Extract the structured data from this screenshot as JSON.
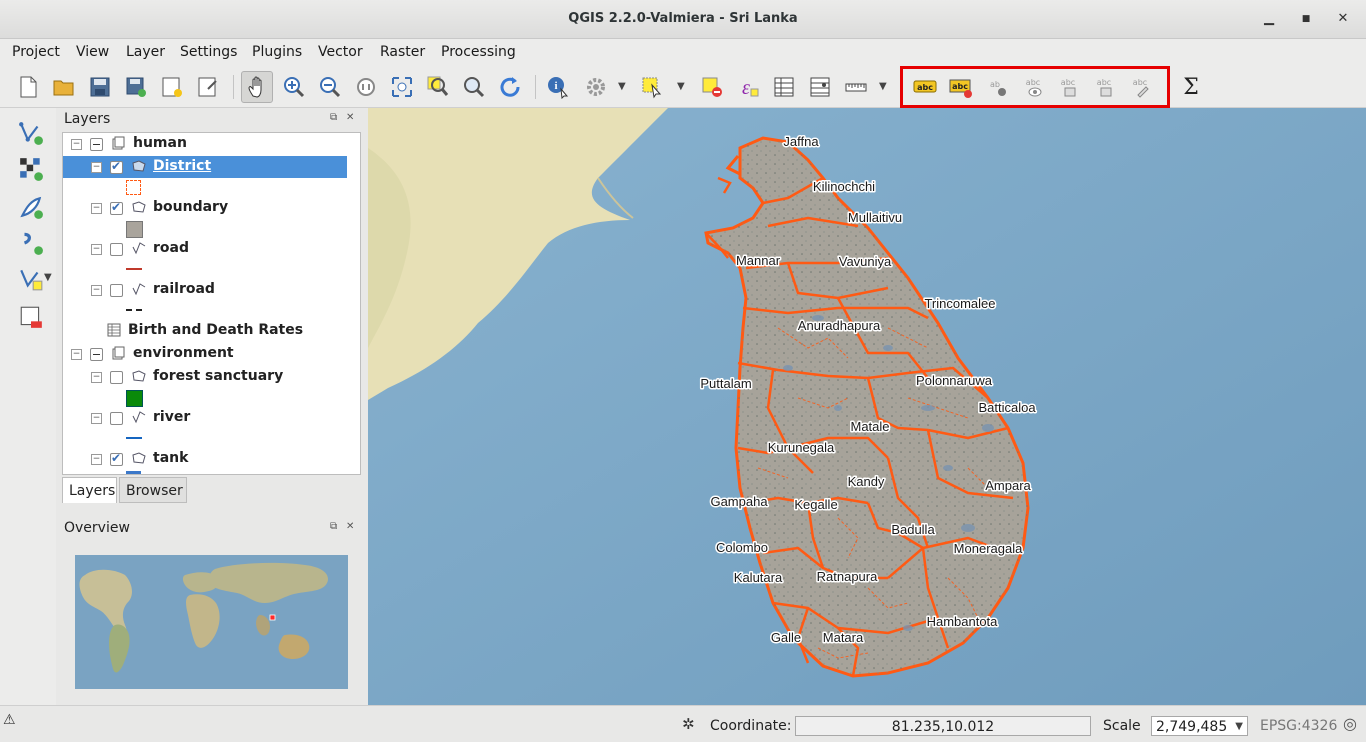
{
  "window": {
    "title": "QGIS 2.2.0-Valmiera - Sri Lanka",
    "minimize": "▁",
    "maximize": "■",
    "close": "✕"
  },
  "menu": [
    "Project",
    "View",
    "Layer",
    "Settings",
    "Plugins",
    "Vector",
    "Raster",
    "Processing"
  ],
  "toolbar": {
    "file": [
      "new-project",
      "open-project",
      "save-project",
      "save-as",
      "new-print-composer",
      "composer-manager"
    ],
    "nav": [
      "pan",
      "zoom-in",
      "zoom-out",
      "zoom-native",
      "zoom-full",
      "zoom-to-selection",
      "zoom-to-layer",
      "refresh"
    ],
    "attrib": [
      "identify",
      "run-action",
      "select-features",
      "deselect",
      "field-calculator",
      "attribute-table",
      "statistics",
      "measure"
    ],
    "label_tools": [
      "layer-labeling",
      "pin-labels",
      "highlight-pinned",
      "show-hide-labels",
      "move-label",
      "rotate-label",
      "change-label"
    ],
    "sum_label": "Σ",
    "abc": "abc",
    "ab": "ab"
  },
  "layers_panel": {
    "title": "Layers",
    "items": [
      {
        "label": "human"
      },
      {
        "label": "District"
      },
      {
        "label": "boundary"
      },
      {
        "label": "road"
      },
      {
        "label": "railroad"
      },
      {
        "label": "Birth and Death Rates"
      },
      {
        "label": "environment"
      },
      {
        "label": "forest sanctuary"
      },
      {
        "label": "river"
      },
      {
        "label": "tank"
      }
    ],
    "tabs": [
      "Layers",
      "Browser"
    ]
  },
  "overview_panel": {
    "title": "Overview"
  },
  "map": {
    "labels": [
      "Jaffna",
      "Kilinochchi",
      "Mullaitivu",
      "Mannar",
      "Vavuniya",
      "Trincomalee",
      "Anuradhapura",
      "Puttalam",
      "Polonnaruwa",
      "Batticaloa",
      "Matale",
      "Kurunegala",
      "Kandy",
      "Ampara",
      "Gampaha",
      "Kegalle",
      "Badulla",
      "Colombo",
      "Moneragala",
      "Kalutara",
      "Ratnapura",
      "Hambantota",
      "Galle",
      "Matara"
    ],
    "colors": {
      "ocean": "#7ea9c6",
      "land": "#a4a097",
      "boundary": "#ff5a14"
    }
  },
  "status": {
    "coord_label": "Coordinate:",
    "coord_value": "81.235,10.012",
    "scale_label": "Scale",
    "scale_value": "2,749,485",
    "crs": "EPSG:4326"
  }
}
